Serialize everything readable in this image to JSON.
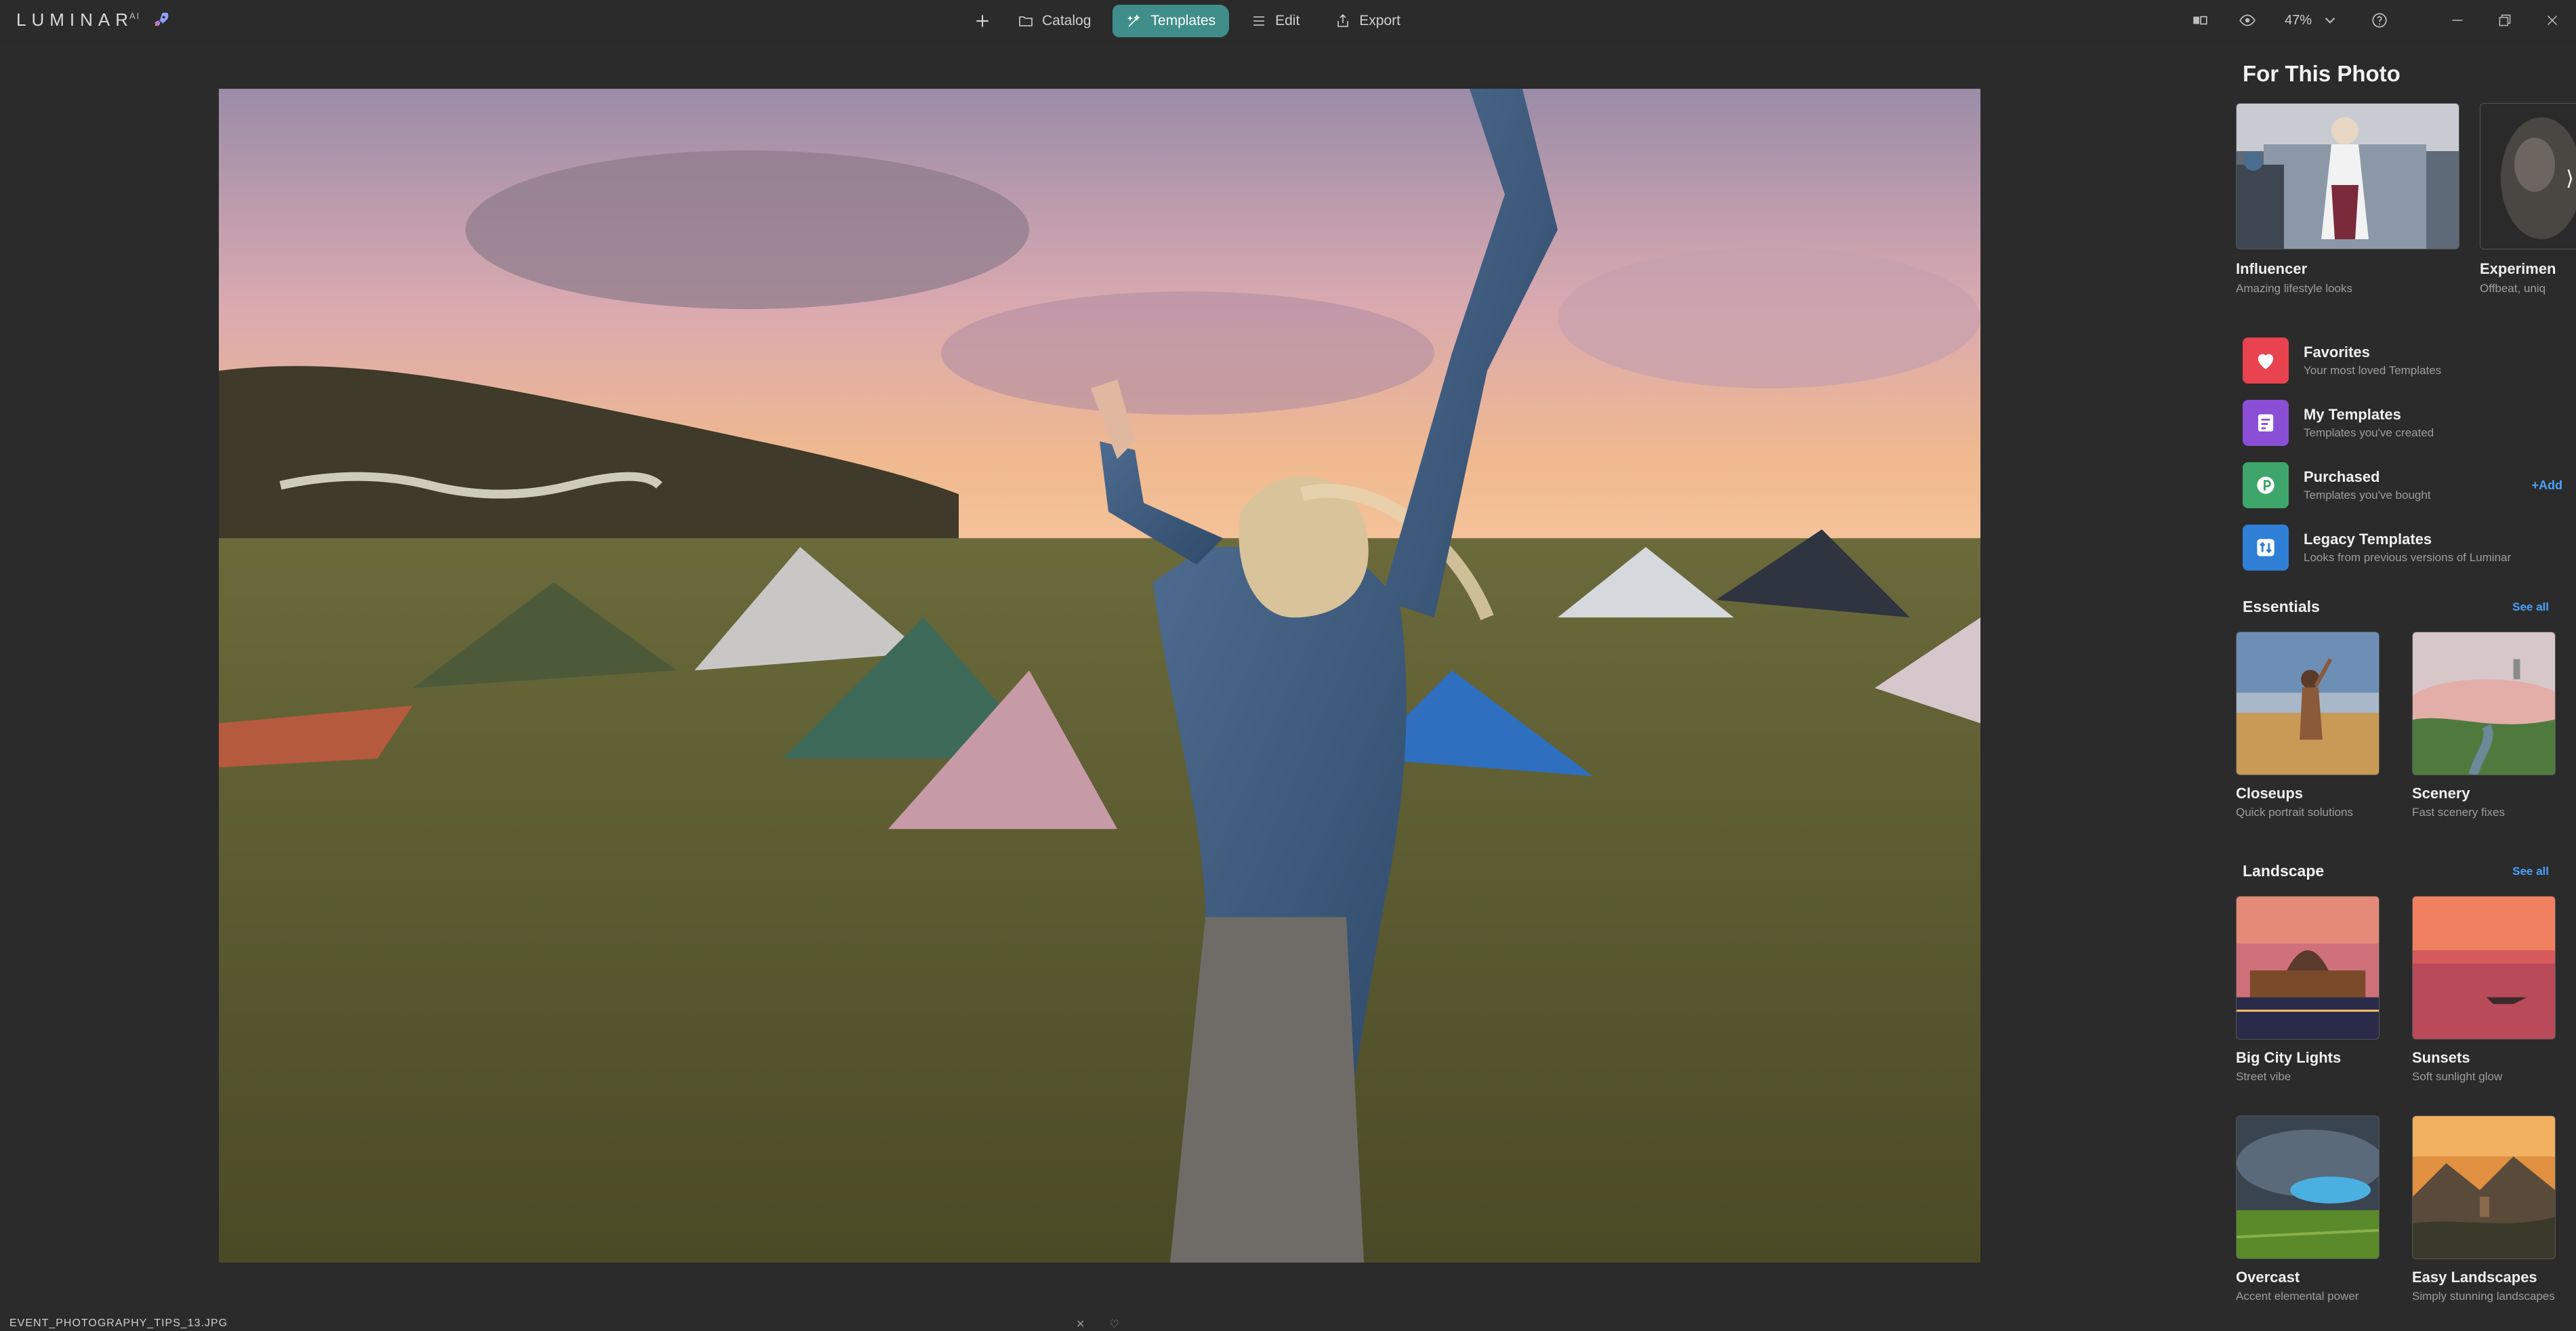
{
  "app": {
    "brand": "LUMINAR",
    "brand_sup": "AI"
  },
  "nav": {
    "items": [
      {
        "label": "Catalog",
        "icon": "folder-icon"
      },
      {
        "label": "Templates",
        "icon": "templates-icon",
        "active": true
      },
      {
        "label": "Edit",
        "icon": "sliders-icon"
      },
      {
        "label": "Export",
        "icon": "export-icon"
      }
    ]
  },
  "toolbar": {
    "zoom": "47%"
  },
  "photo": {
    "filename": "EVENT_PHOTOGRAPHY_TIPS_13.JPG"
  },
  "panel": {
    "title": "For This Photo",
    "featured": [
      {
        "title": "Influencer",
        "subtitle": "Amazing lifestyle looks"
      },
      {
        "title": "Experimen",
        "subtitle": "Offbeat, uniq"
      }
    ],
    "collections": [
      {
        "title": "Favorites",
        "subtitle": "Your most loved Templates",
        "color": "#e8434f",
        "icon": "heart-icon"
      },
      {
        "title": "My Templates",
        "subtitle": "Templates you've created",
        "color": "#8a4fd6",
        "icon": "template-list-icon"
      },
      {
        "title": "Purchased",
        "subtitle": "Templates you've bought",
        "color": "#3ea66a",
        "icon": "purchase-icon",
        "action": "+Add"
      },
      {
        "title": "Legacy Templates",
        "subtitle": "Looks from previous versions of Luminar",
        "color": "#2f7fd6",
        "icon": "legacy-icon"
      }
    ],
    "sections": [
      {
        "title": "Essentials",
        "see_all": "See all",
        "items": [
          {
            "title": "Closeups",
            "subtitle": "Quick portrait solutions"
          },
          {
            "title": "Scenery",
            "subtitle": "Fast scenery fixes"
          }
        ]
      },
      {
        "title": "Landscape",
        "see_all": "See all",
        "items": [
          {
            "title": "Big City Lights",
            "subtitle": "Street vibe"
          },
          {
            "title": "Sunsets",
            "subtitle": "Soft sunlight glow"
          },
          {
            "title": "Overcast",
            "subtitle": "Accent elemental power"
          },
          {
            "title": "Easy Landscapes",
            "subtitle": "Simply stunning landscapes"
          }
        ]
      }
    ]
  },
  "colors": {
    "accent": "#3f8e8a",
    "link": "#4aa3ff",
    "background": "#2b2b2b"
  }
}
